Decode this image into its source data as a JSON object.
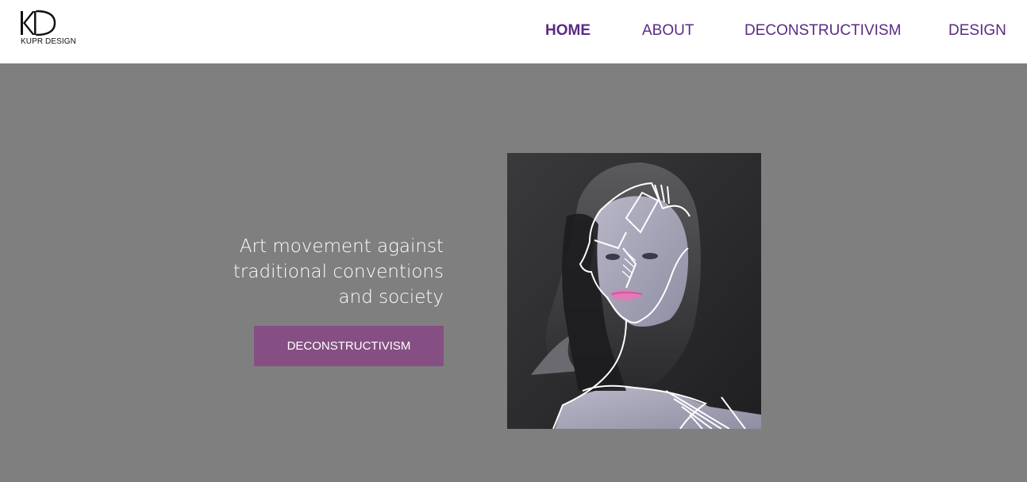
{
  "logo": {
    "mark": "KD",
    "text": "KUPR DESIGN"
  },
  "nav": {
    "items": [
      {
        "label": "HOME",
        "active": true
      },
      {
        "label": "ABOUT",
        "active": false
      },
      {
        "label": "DECONSTRUCTIVISM",
        "active": false
      },
      {
        "label": "DESIGN",
        "active": false
      }
    ]
  },
  "hero": {
    "tagline": [
      "Art movement against",
      "traditional conventions",
      "and society"
    ],
    "cta_label": "DECONSTRUCTIVISM"
  },
  "colors": {
    "accent": "#5a2a84",
    "button": "#854f83",
    "hero_background": "#7f7f7f",
    "lips": "#e07ab8"
  }
}
